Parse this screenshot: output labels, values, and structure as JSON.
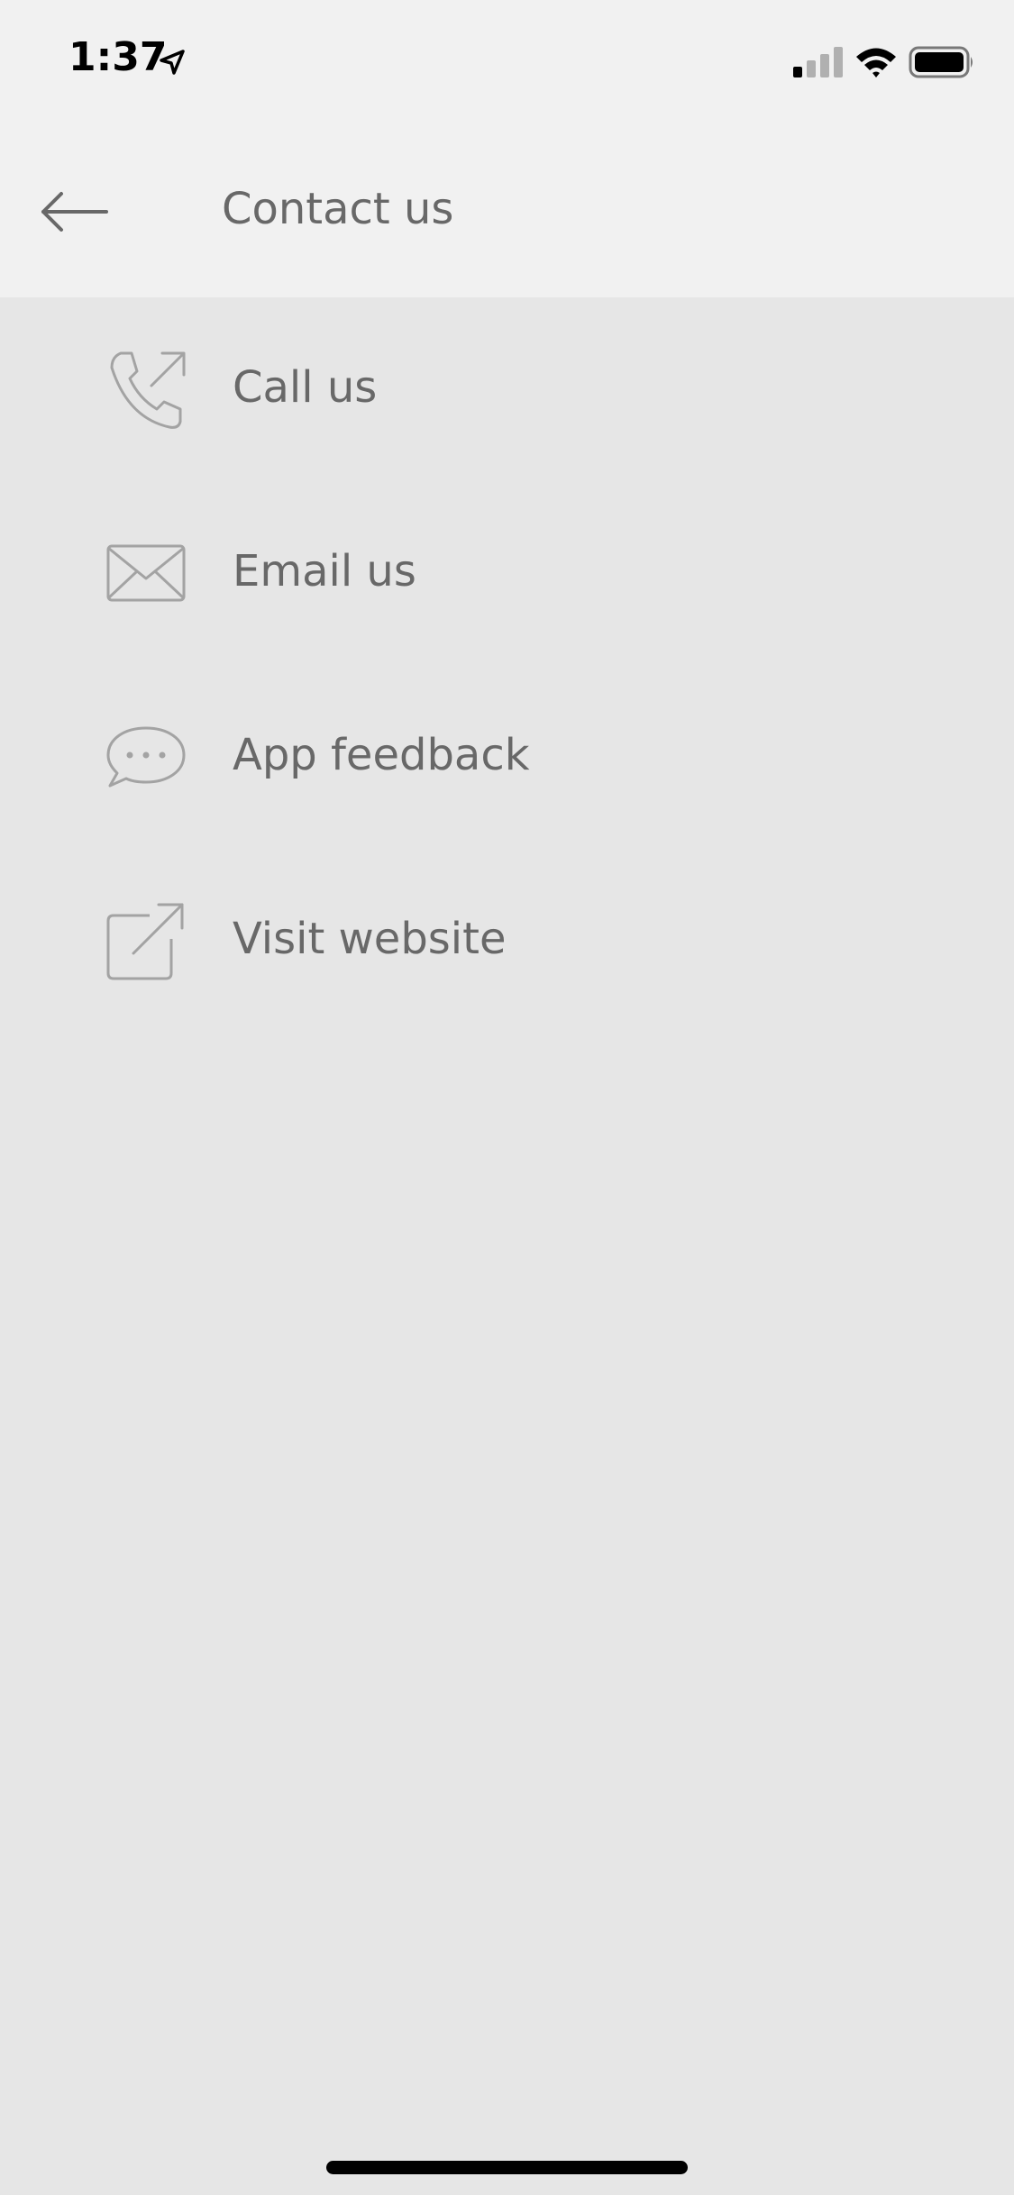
{
  "status_bar": {
    "time": "1:37",
    "icons": [
      "location-arrow-icon",
      "cellular-signal-icon",
      "wifi-icon",
      "battery-icon"
    ]
  },
  "header": {
    "back_icon": "arrow-left-icon",
    "title": "Contact us"
  },
  "menu": {
    "items": [
      {
        "label": "Call us",
        "icon": "phone-outgoing-icon"
      },
      {
        "label": "Email us",
        "icon": "envelope-icon"
      },
      {
        "label": "App feedback",
        "icon": "speech-bubble-icon"
      },
      {
        "label": "Visit website",
        "icon": "external-link-icon"
      }
    ]
  },
  "colors": {
    "header_background": "#f1f1f1",
    "page_background": "#e6e6e6",
    "text": "#686868",
    "icon_stroke": "#a3a3a3"
  }
}
